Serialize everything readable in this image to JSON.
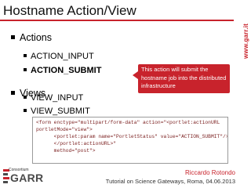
{
  "slide": {
    "title": "Hostname Action/View",
    "site": "www.garr.it",
    "page_number": ""
  },
  "bullets": [
    {
      "label": "Actions",
      "children": [
        {
          "label": "ACTION_INPUT",
          "bold": false
        },
        {
          "label": "ACTION_SUBMIT",
          "bold": true
        }
      ]
    },
    {
      "label": "Views",
      "children": [
        {
          "label": "VIEW_INPUT",
          "bold": false
        },
        {
          "label": "VIEW_SUBMIT",
          "bold": false
        }
      ]
    }
  ],
  "callout": {
    "text": "This action will submit the hostname job into the distributed infrastructure"
  },
  "code": {
    "lines": [
      "<form enctype=\"multipart/form-data\" action=\"<portlet:actionURL",
      "portletMode=\"view\">",
      "      <portlet:param name=\"PortletStatus\" value=\"ACTION_SUBMIT\"/>",
      "      </portlet:actionURL>\"",
      "      method=\"post\">"
    ]
  },
  "footer": {
    "logo_top": "Consortium",
    "logo_main": "GARR",
    "author": "Riccardo Rotondo",
    "event": "Tutorial on Science Gateways, Roma, 04.06.2013"
  },
  "colors": {
    "accent": "#c8232c"
  }
}
